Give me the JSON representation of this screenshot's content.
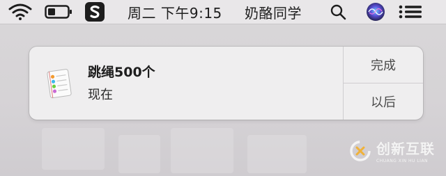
{
  "menubar": {
    "clock_text": "周二 下午9:15",
    "user_name": "奶酪同学"
  },
  "notification": {
    "title": "跳绳500个",
    "time": "现在",
    "actions": [
      "完成",
      "以后"
    ]
  },
  "watermark": {
    "brand": "创新互联",
    "sub": "CHUANG XIN HU LIAN"
  },
  "colors": {
    "menubar_bg": "#e9e7e9",
    "notification_bg": "#efeeef",
    "desktop_bg": "#d9d6d8"
  },
  "icons": [
    "wifi-icon",
    "battery-icon",
    "sogou-input-icon",
    "search-icon",
    "siri-icon",
    "notification-center-icon",
    "reminders-app-icon",
    "watermark-logo-icon"
  ]
}
